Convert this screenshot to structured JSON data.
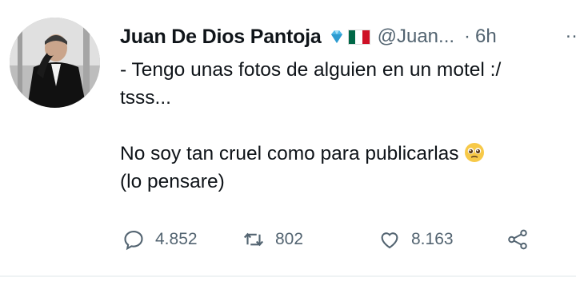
{
  "tweet": {
    "author_name": "Juan De Dios Pantoja",
    "handle": "@Juan...",
    "dot": "·",
    "time": "6h",
    "line1": "- Tengo unas fotos de alguien en un motel :/",
    "line2": "tsss...",
    "line3": "No soy tan cruel como para publicarlas",
    "line4": "(lo pensare)",
    "more": "…"
  },
  "actions": {
    "reply_count": "4.852",
    "retweet_count": "802",
    "like_count": "8.163"
  },
  "icons": {
    "verified": "diamond-badge-icon",
    "flag": "mexico-flag-icon",
    "emoji": "pleading-face-emoji-icon",
    "reply": "reply-icon",
    "retweet": "retweet-icon",
    "like": "heart-icon",
    "share": "share-icon"
  },
  "colors": {
    "text": "#0f1419",
    "secondary": "#536471",
    "divider": "#eff3f4"
  }
}
